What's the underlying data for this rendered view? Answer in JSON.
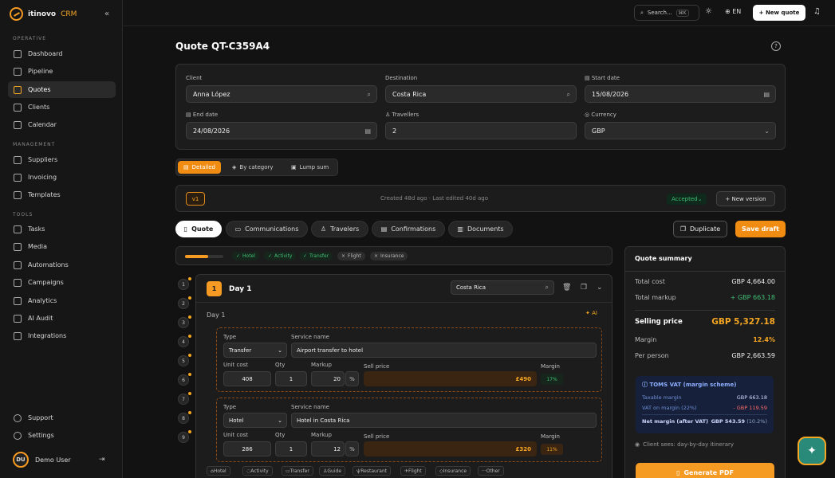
{
  "brand": {
    "name": "itinovo",
    "suffix": "CRM"
  },
  "sidebar": {
    "sections": [
      {
        "label": "OPERATIVE",
        "items": [
          "Dashboard",
          "Pipeline",
          "Quotes",
          "Clients",
          "Calendar"
        ]
      },
      {
        "label": "MANAGEMENT",
        "items": [
          "Suppliers",
          "Invoicing",
          "Templates"
        ]
      },
      {
        "label": "TOOLS",
        "items": [
          "Tasks",
          "Media",
          "Automations",
          "Campaigns",
          "Analytics",
          "AI Audit",
          "Integrations"
        ]
      }
    ],
    "active": "Quotes",
    "footer": [
      "Support",
      "Settings"
    ],
    "user": {
      "initials": "DU",
      "name": "Demo User"
    }
  },
  "topbar": {
    "search": "Search...",
    "shortcut": "⌘K",
    "lang": "EN",
    "new_quote": "+ New quote"
  },
  "page": {
    "title": "Quote QT-C359A4"
  },
  "form": {
    "client_label": "Client",
    "client": "Anna López",
    "destination_label": "Destination",
    "destination": "Costa Rica",
    "start_label": "Start date",
    "start": "15/08/2026",
    "end_label": "End date",
    "end": "24/08/2026",
    "travellers_label": "Travellers",
    "travellers": "2",
    "currency_label": "Currency",
    "currency": "GBP"
  },
  "views": [
    "Detailed",
    "By category",
    "Lump sum"
  ],
  "version": {
    "tag": "v1",
    "meta": "Created 48d ago · Last edited 40d ago",
    "status": "Accepted",
    "new_version": "+ New version"
  },
  "tabs": [
    "Quote",
    "Communications",
    "Travelers",
    "Confirmations",
    "Documents"
  ],
  "actions": {
    "duplicate": "Duplicate",
    "save": "Save draft"
  },
  "progress": {
    "fraction": 0.6,
    "chips": [
      {
        "label": "Hotel",
        "done": true
      },
      {
        "label": "Activity",
        "done": true
      },
      {
        "label": "Transfer",
        "done": true
      },
      {
        "label": "Flight",
        "done": false
      },
      {
        "label": "Insurance",
        "done": false
      }
    ]
  },
  "rail": [
    "1",
    "2",
    "3",
    "4",
    "5",
    "6",
    "7",
    "8",
    "9"
  ],
  "day": {
    "num": "1",
    "title": "Day 1",
    "location": "Costa Rica",
    "subtitle": "Day 1",
    "ai": "AI",
    "labels": {
      "type": "Type",
      "service": "Service name",
      "unit": "Unit cost",
      "qty": "Qty",
      "markup": "Markup",
      "sell": "Sell price",
      "margin": "Margin"
    },
    "services": [
      {
        "type": "Transfer",
        "name": "Airport transfer to hotel",
        "unit": "408",
        "qty": "1",
        "markup": "20",
        "pct": "%",
        "sell": "£490",
        "margin": "17%"
      },
      {
        "type": "Hotel",
        "name": "Hotel in Costa Rica",
        "unit": "286",
        "qty": "1",
        "markup": "12",
        "pct": "%",
        "sell": "£320",
        "margin": "11%"
      }
    ],
    "add": [
      "Hotel",
      "Activity",
      "Transfer",
      "Guide",
      "Restaurant",
      "Flight",
      "Insurance",
      "Other"
    ]
  },
  "summary": {
    "title": "Quote summary",
    "total_cost_label": "Total cost",
    "total_cost": "GBP 4,664.00",
    "markup_label": "Total markup",
    "markup": "+ GBP 663.18",
    "selling_label": "Selling price",
    "selling": "GBP 5,327.18",
    "margin_label": "Margin",
    "margin": "12.4%",
    "pp_label": "Per person",
    "pp": "GBP 2,663.59",
    "vat": {
      "title": "TOMS VAT (margin scheme)",
      "taxable_label": "Taxable margin",
      "taxable": "GBP 663.18",
      "vat_label": "VAT on margin (22%)",
      "vat": "- GBP 119.59",
      "net_label": "Net margin (after VAT)",
      "net": "GBP 543.59",
      "net_pct": "(10.2%)"
    },
    "client_sees": "Client sees: day-by-day itinerary",
    "generate": "Generate PDF"
  },
  "colors": {
    "accent": "#f59a23",
    "success": "#3fbf74",
    "bg": "#121212"
  }
}
